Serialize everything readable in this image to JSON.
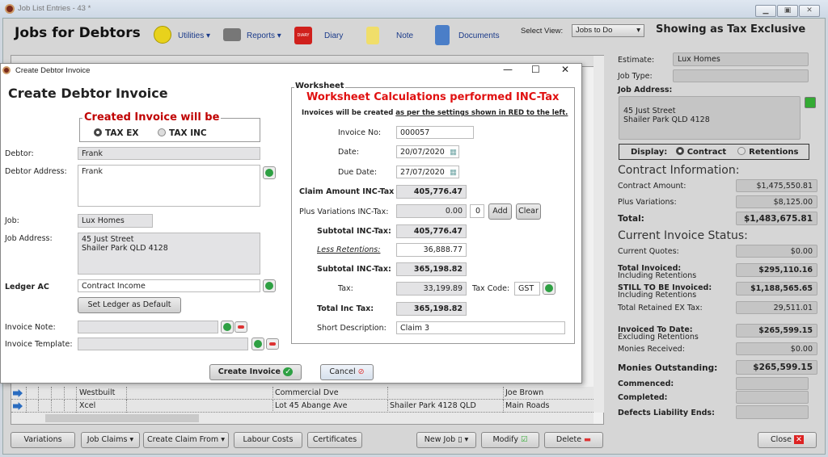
{
  "window": {
    "title": "Job List Entries - 43 *",
    "page_title": "Jobs for Debtors"
  },
  "toolbar": {
    "utilities": "Utilities",
    "reports": "Reports",
    "diary_icon_text": "DIARY",
    "diary": "Diary",
    "note": "Note",
    "documents": "Documents",
    "select_view_label": "Select View:",
    "select_view_value": "Jobs to Do",
    "tax_mode": "Showing as Tax Exclusive"
  },
  "grid": {
    "rows": [
      {
        "name": "Westbuilt",
        "address": "Commercial Dve",
        "suburb": "",
        "contact": "Joe Brown"
      },
      {
        "name": "Xcel",
        "address": "Lot 45 Abange Ave",
        "suburb": "Shailer Park 4128 QLD",
        "contact": "Main Roads"
      }
    ]
  },
  "right_panel": {
    "estimate_label": "Estimate:",
    "estimate": "Lux Homes",
    "job_type_label": "Job Type:",
    "job_type": "",
    "job_address_label": "Job Address:",
    "job_address_1": "45 Just Street",
    "job_address_2": "Shailer Park QLD 4128",
    "display_label": "Display:",
    "display_contract": "Contract",
    "display_retentions": "Retentions",
    "contract_heading": "Contract Information:",
    "contract_amount_label": "Contract Amount:",
    "contract_amount": "$1,475,550.81",
    "plus_variations_label": "Plus Variations:",
    "plus_variations": "$8,125.00",
    "total_label": "Total:",
    "total": "$1,483,675.81",
    "status_heading": "Current Invoice Status:",
    "current_quotes_label": "Current Quotes:",
    "current_quotes": "$0.00",
    "total_invoiced_label": "Total Invoiced:",
    "total_invoiced_sub": "Including Retentions",
    "total_invoiced": "$295,110.16",
    "still_label": "STILL TO BE Invoiced:",
    "still_sub": "Including Retentions",
    "still": "$1,188,565.65",
    "retained_label": "Total Retained EX Tax:",
    "retained": "29,511.01",
    "to_date_label": "Invoiced To Date:",
    "to_date_sub": "Excluding Retentions",
    "to_date": "$265,599.15",
    "received_label": "Monies Received:",
    "received": "$0.00",
    "outstanding_label": "Monies Outstanding:",
    "outstanding": "$265,599.15",
    "commenced_label": "Commenced:",
    "completed_label": "Completed:",
    "defects_label": "Defects Liability Ends:"
  },
  "bottom": {
    "variations": "Variations",
    "job_claims": "Job Claims",
    "create_claim_from": "Create Claim From",
    "labour_costs": "Labour Costs",
    "certificates": "Certificates",
    "new_job": "New Job",
    "modify": "Modify",
    "delete": "Delete",
    "close": "Close"
  },
  "dialog": {
    "title": "Create Debtor Invoice",
    "heading": "Create Debtor Invoice",
    "created_legend": "Created Invoice will be",
    "tax_ex": "TAX EX",
    "tax_inc": "TAX INC",
    "debtor_label": "Debtor:",
    "debtor": "Frank",
    "debtor_address_label": "Debtor Address:",
    "debtor_address": "Frank",
    "job_label": "Job:",
    "job": "Lux Homes",
    "job_address_label": "Job Address:",
    "job_address_1": "45 Just Street",
    "job_address_2": "Shailer Park QLD 4128",
    "ledger_label": "Ledger AC",
    "ledger": "Contract Income",
    "set_ledger": "Set Ledger as Default",
    "invoice_note_label": "Invoice Note:",
    "invoice_template_label": "Invoice Template:",
    "create_invoice": "Create Invoice",
    "cancel": "Cancel",
    "worksheet": {
      "legend": "Worksheet",
      "heading": "Worksheet Calculations performed INC-Tax",
      "note_prefix": "Invoices will be created ",
      "note_link": "as per the settings shown in RED to the left.",
      "invoice_no_label": "Invoice No:",
      "invoice_no": "000057",
      "date_label": "Date:",
      "date": "20/07/2020",
      "due_label": "Due Date:",
      "due": "27/07/2020",
      "claim_label": "Claim Amount INC-Tax",
      "claim": "405,776.47",
      "var_label": "Plus Variations INC-Tax:",
      "var": "0.00",
      "var_count": "0",
      "add": "Add",
      "clear": "Clear",
      "subtotal1_label": "Subtotal INC-Tax:",
      "subtotal1": "405,776.47",
      "less_ret_label": "Less Retentions:",
      "less_ret": "36,888.77",
      "subtotal2_label": "Subtotal INC-Tax:",
      "subtotal2": "365,198.82",
      "tax_label": "Tax:",
      "tax": "33,199.89",
      "tax_code_label": "Tax Code:",
      "tax_code": "GST",
      "total_label": "Total Inc Tax:",
      "total": "365,198.82",
      "short_desc_label": "Short Description:",
      "short_desc": "Claim 3"
    }
  },
  "colors": {
    "accent_red": "#e01010",
    "dark_red": "#c00000",
    "link_blue": "#1a3a8a"
  }
}
